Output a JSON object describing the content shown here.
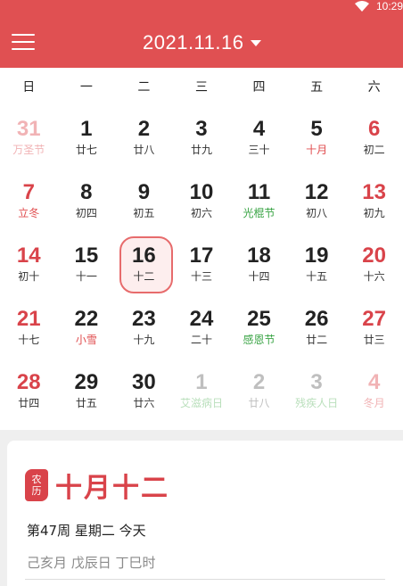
{
  "status_bar": {
    "time": "10:29"
  },
  "header": {
    "date": "2021.11.16",
    "menu_icon": "menu-icon",
    "dropdown_icon": "caret-down-icon"
  },
  "weekdays": [
    "日",
    "一",
    "二",
    "三",
    "四",
    "五",
    "六"
  ],
  "days": [
    {
      "num": "31",
      "sub": "万圣节",
      "other": true,
      "weekend": true,
      "sub_style": ""
    },
    {
      "num": "1",
      "sub": "廿七",
      "other": false,
      "weekend": false,
      "sub_style": ""
    },
    {
      "num": "2",
      "sub": "廿八",
      "other": false,
      "weekend": false,
      "sub_style": ""
    },
    {
      "num": "3",
      "sub": "廿九",
      "other": false,
      "weekend": false,
      "sub_style": ""
    },
    {
      "num": "4",
      "sub": "三十",
      "other": false,
      "weekend": false,
      "sub_style": ""
    },
    {
      "num": "5",
      "sub": "十月",
      "other": false,
      "weekend": false,
      "sub_style": "red"
    },
    {
      "num": "6",
      "sub": "初二",
      "other": false,
      "weekend": true,
      "sub_style": ""
    },
    {
      "num": "7",
      "sub": "立冬",
      "other": false,
      "weekend": true,
      "sub_style": "red"
    },
    {
      "num": "8",
      "sub": "初四",
      "other": false,
      "weekend": false,
      "sub_style": ""
    },
    {
      "num": "9",
      "sub": "初五",
      "other": false,
      "weekend": false,
      "sub_style": ""
    },
    {
      "num": "10",
      "sub": "初六",
      "other": false,
      "weekend": false,
      "sub_style": ""
    },
    {
      "num": "11",
      "sub": "光棍节",
      "other": false,
      "weekend": false,
      "sub_style": "green"
    },
    {
      "num": "12",
      "sub": "初八",
      "other": false,
      "weekend": false,
      "sub_style": ""
    },
    {
      "num": "13",
      "sub": "初九",
      "other": false,
      "weekend": true,
      "sub_style": ""
    },
    {
      "num": "14",
      "sub": "初十",
      "other": false,
      "weekend": true,
      "sub_style": ""
    },
    {
      "num": "15",
      "sub": "十一",
      "other": false,
      "weekend": false,
      "sub_style": ""
    },
    {
      "num": "16",
      "sub": "十二",
      "other": false,
      "weekend": false,
      "sub_style": "",
      "selected": true
    },
    {
      "num": "17",
      "sub": "十三",
      "other": false,
      "weekend": false,
      "sub_style": ""
    },
    {
      "num": "18",
      "sub": "十四",
      "other": false,
      "weekend": false,
      "sub_style": ""
    },
    {
      "num": "19",
      "sub": "十五",
      "other": false,
      "weekend": false,
      "sub_style": ""
    },
    {
      "num": "20",
      "sub": "十六",
      "other": false,
      "weekend": true,
      "sub_style": ""
    },
    {
      "num": "21",
      "sub": "十七",
      "other": false,
      "weekend": true,
      "sub_style": ""
    },
    {
      "num": "22",
      "sub": "小雪",
      "other": false,
      "weekend": false,
      "sub_style": "red"
    },
    {
      "num": "23",
      "sub": "十九",
      "other": false,
      "weekend": false,
      "sub_style": ""
    },
    {
      "num": "24",
      "sub": "二十",
      "other": false,
      "weekend": false,
      "sub_style": ""
    },
    {
      "num": "25",
      "sub": "感恩节",
      "other": false,
      "weekend": false,
      "sub_style": "green"
    },
    {
      "num": "26",
      "sub": "廿二",
      "other": false,
      "weekend": false,
      "sub_style": ""
    },
    {
      "num": "27",
      "sub": "廿三",
      "other": false,
      "weekend": true,
      "sub_style": ""
    },
    {
      "num": "28",
      "sub": "廿四",
      "other": false,
      "weekend": true,
      "sub_style": ""
    },
    {
      "num": "29",
      "sub": "廿五",
      "other": false,
      "weekend": false,
      "sub_style": ""
    },
    {
      "num": "30",
      "sub": "廿六",
      "other": false,
      "weekend": false,
      "sub_style": ""
    },
    {
      "num": "1",
      "sub": "艾滋病日",
      "other": true,
      "weekend": false,
      "sub_style": "green"
    },
    {
      "num": "2",
      "sub": "廿八",
      "other": true,
      "weekend": false,
      "sub_style": ""
    },
    {
      "num": "3",
      "sub": "残疾人日",
      "other": true,
      "weekend": false,
      "sub_style": "green"
    },
    {
      "num": "4",
      "sub": "冬月",
      "other": true,
      "weekend": true,
      "sub_style": ""
    }
  ],
  "detail": {
    "seal_top": "农",
    "seal_bottom": "历",
    "lunar_date": "十月十二",
    "week_info": "第47周 星期二 今天",
    "ganzhi": "己亥月 戊辰日 丁巳时"
  },
  "colors": {
    "primary": "#e05052",
    "weekend": "#d9434a",
    "festival_green": "#3aa445"
  }
}
